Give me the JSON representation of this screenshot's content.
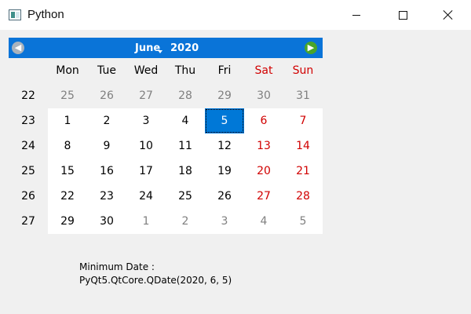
{
  "window": {
    "title": "Python",
    "icon": "python-window-icon",
    "controls": [
      "minimize",
      "maximize",
      "close"
    ]
  },
  "calendar": {
    "month": "June",
    "year": "2020",
    "prev_icon": "left-arrow-icon",
    "next_icon": "right-arrow-icon",
    "weekdays": [
      "Mon",
      "Tue",
      "Wed",
      "Thu",
      "Fri",
      "Sat",
      "Sun"
    ],
    "weeks": [
      {
        "week": "22",
        "days": [
          "25",
          "26",
          "27",
          "28",
          "29",
          "30",
          "31"
        ]
      },
      {
        "week": "23",
        "days": [
          "1",
          "2",
          "3",
          "4",
          "5",
          "6",
          "7"
        ]
      },
      {
        "week": "24",
        "days": [
          "8",
          "9",
          "10",
          "11",
          "12",
          "13",
          "14"
        ]
      },
      {
        "week": "25",
        "days": [
          "15",
          "16",
          "17",
          "18",
          "19",
          "20",
          "21"
        ]
      },
      {
        "week": "26",
        "days": [
          "22",
          "23",
          "24",
          "25",
          "26",
          "27",
          "28"
        ]
      },
      {
        "week": "27",
        "days": [
          "29",
          "30",
          "1",
          "2",
          "3",
          "4",
          "5"
        ]
      }
    ],
    "selected_day": "5",
    "colors": {
      "nav_bar": "#0a74d8",
      "weekend_text": "#d10000",
      "selected_bg": "#0078d7",
      "other_month_text": "#808080"
    }
  },
  "status": {
    "text": "Minimum Date : PyQt5.QtCore.QDate(2020, 6, 5)"
  }
}
